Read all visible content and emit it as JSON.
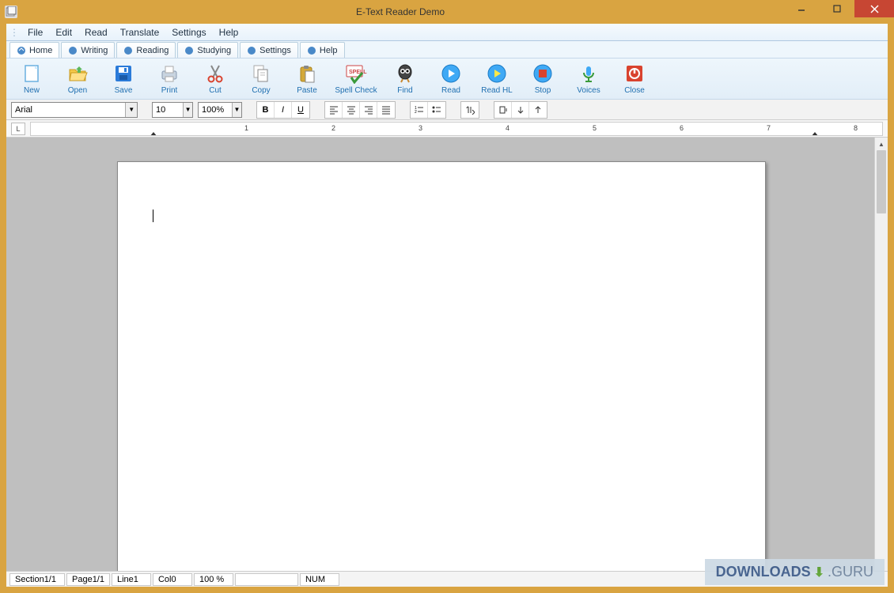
{
  "window": {
    "title": "E-Text Reader Demo"
  },
  "menu": {
    "items": [
      "File",
      "Edit",
      "Read",
      "Translate",
      "Settings",
      "Help"
    ]
  },
  "tabs": {
    "items": [
      "Home",
      "Writing",
      "Reading",
      "Studying",
      "Settings",
      "Help"
    ],
    "active": 0
  },
  "toolbar": {
    "buttons": [
      {
        "id": "new",
        "label": "New"
      },
      {
        "id": "open",
        "label": "Open"
      },
      {
        "id": "save",
        "label": "Save"
      },
      {
        "id": "print",
        "label": "Print"
      },
      {
        "id": "cut",
        "label": "Cut"
      },
      {
        "id": "copy",
        "label": "Copy"
      },
      {
        "id": "paste",
        "label": "Paste"
      },
      {
        "id": "spellcheck",
        "label": "Spell Check"
      },
      {
        "id": "find",
        "label": "Find"
      },
      {
        "id": "read",
        "label": "Read"
      },
      {
        "id": "readhl",
        "label": "Read HL"
      },
      {
        "id": "stop",
        "label": "Stop"
      },
      {
        "id": "voices",
        "label": "Voices"
      },
      {
        "id": "close",
        "label": "Close"
      }
    ]
  },
  "format": {
    "font": "Arial",
    "size": "10",
    "zoom": "100%",
    "bold": "B",
    "italic": "I",
    "underline": "U"
  },
  "ruler": {
    "marks": [
      "1",
      "2",
      "3",
      "4",
      "5",
      "6",
      "7",
      "8"
    ]
  },
  "status": {
    "section": "Section1/1",
    "page": "Page1/1",
    "line": "Line1",
    "col": "Col0",
    "zoom": "100 %",
    "num": "NUM"
  },
  "watermark": {
    "left": "DOWNLOADS",
    "right": ".GURU"
  }
}
